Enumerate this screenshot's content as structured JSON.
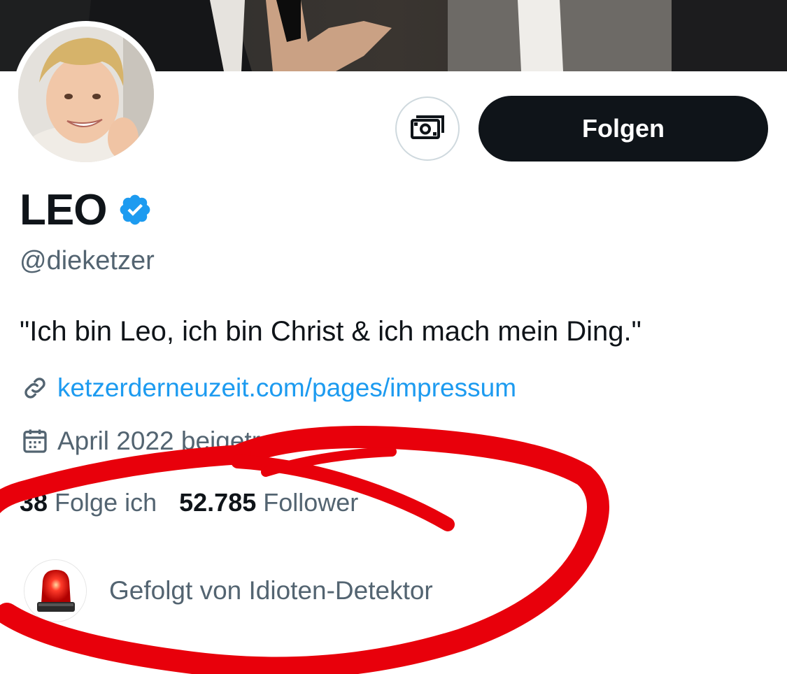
{
  "profile": {
    "name": "LEO",
    "handle": "@dieketzer",
    "bio": "\"Ich bin Leo, ich bin Christ & ich mach mein Ding.\"",
    "link": "ketzerderneuzeit.com/pages/impressum",
    "joined": "April 2022 beigetreten",
    "verified_icon": "verified-badge-icon",
    "colors": {
      "verified": "#1d9bf0",
      "link": "#1d9bf0",
      "button": "#0f1419",
      "secondary_text": "#536471",
      "annotation": "#e8000b"
    }
  },
  "actions": {
    "follow_label": "Folgen",
    "subscribe_icon": "money-icon"
  },
  "stats": {
    "following_count": "38",
    "following_label": "Folge ich",
    "followers_count": "52.785",
    "followers_label": "Follower"
  },
  "followed_by": {
    "text": "Gefolgt von Idioten-Detektor",
    "avatar_icon": "siren-icon"
  }
}
